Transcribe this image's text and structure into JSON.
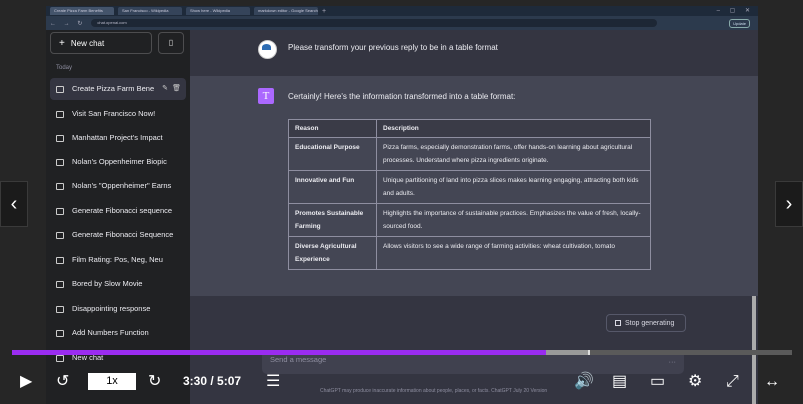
{
  "browser": {
    "tabs": [
      "Create Pizza Farm Benefits",
      "San Francisco - Wikipedia",
      "Show here - Wikipedia",
      "markdown editor - Google Search"
    ],
    "url": "chat.openai.com",
    "update_label": "Update"
  },
  "sidebar": {
    "new_chat_label": "New chat",
    "section_label": "Today",
    "items": [
      {
        "label": "Create Pizza Farm Bene"
      },
      {
        "label": "Visit San Francisco Now!"
      },
      {
        "label": "Manhattan Project's Impact"
      },
      {
        "label": "Nolan's Oppenheimer Biopic"
      },
      {
        "label": "Nolan's \"Oppenheimer\" Earns"
      },
      {
        "label": "Generate Fibonacci sequence"
      },
      {
        "label": "Generate Fibonacci Sequence"
      },
      {
        "label": "Film Rating: Pos, Neg, Neu"
      },
      {
        "label": "Bored by Slow Movie"
      },
      {
        "label": "Disappointing response"
      },
      {
        "label": "Add Numbers Function"
      },
      {
        "label": "New chat"
      }
    ]
  },
  "conversation": {
    "user_message": "Please transform your previous reply to be in a table format",
    "assistant_avatar": "T",
    "assistant_intro": "Certainly! Here's the information transformed into a table format:",
    "table": {
      "headers": [
        "Reason",
        "Description"
      ],
      "rows": [
        [
          "Educational Purpose",
          "Pizza farms, especially demonstration farms, offer hands-on learning about agricultural processes. Understand where pizza ingredients originate."
        ],
        [
          "Innovative and Fun",
          "Unique partitioning of land into pizza slices makes learning engaging, attracting both kids and adults."
        ],
        [
          "Promotes Sustainable Farming",
          "Highlights the importance of sustainable practices. Emphasizes the value of fresh, locally-sourced food."
        ],
        [
          "Diverse Agricultural Experience",
          "Allows visitors to see a wide range of farming activities: wheat cultivation, tomato"
        ]
      ]
    },
    "stop_label": "Stop generating",
    "input_placeholder": "Send a message",
    "disclaimer": "ChatGPT may produce inaccurate information about people, places, or facts. ChatGPT July 20 Version"
  },
  "player": {
    "speed": "1x",
    "time": "3:30 / 5:07",
    "played_fraction": 0.684,
    "buffered_fraction": 0.74
  },
  "colors": {
    "progress": "#9a2cf0",
    "assistant_avatar": "#ab68ff",
    "sidebar_bg": "#202123"
  }
}
